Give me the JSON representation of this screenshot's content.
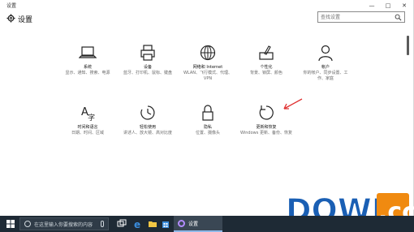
{
  "window": {
    "title": "设置"
  },
  "header": {
    "title": "设置",
    "search_placeholder": "查找设置"
  },
  "tiles": [
    {
      "name": "系统",
      "desc": "显示、通知、搜索、电源",
      "icon": "laptop-icon"
    },
    {
      "name": "设备",
      "desc": "蓝牙、打印机、鼠标、键盘",
      "icon": "printer-icon"
    },
    {
      "name": "网络和 Internet",
      "desc": "WLAN、飞行模式、代理、VPN",
      "icon": "globe-icon"
    },
    {
      "name": "个性化",
      "desc": "背景、锁屏、颜色",
      "icon": "brush-icon"
    },
    {
      "name": "帐户",
      "desc": "你的帐户、同步设置、工作、家庭",
      "icon": "person-icon"
    },
    {
      "name": "时间和语言",
      "desc": "日期、时间、区域",
      "icon": "language-icon"
    },
    {
      "name": "轻松使用",
      "desc": "讲述人、放大镜、高对比度",
      "icon": "timer-icon"
    },
    {
      "name": "隐私",
      "desc": "位置、摄像头",
      "icon": "lock-icon"
    },
    {
      "name": "更新和恢复",
      "desc": "Windows 更新、备份、恢复",
      "icon": "refresh-icon"
    }
  ],
  "taskbar": {
    "search_placeholder": "在这里输入你要搜索的内容",
    "active_app": "设置"
  },
  "watermark": {
    "text": "DOWN.cc"
  },
  "colors": {
    "arrow": "#e03030",
    "taskbar": "#1e2a35",
    "watermark_blue": "#1a5fb4",
    "watermark_orange": "#f08a10"
  }
}
